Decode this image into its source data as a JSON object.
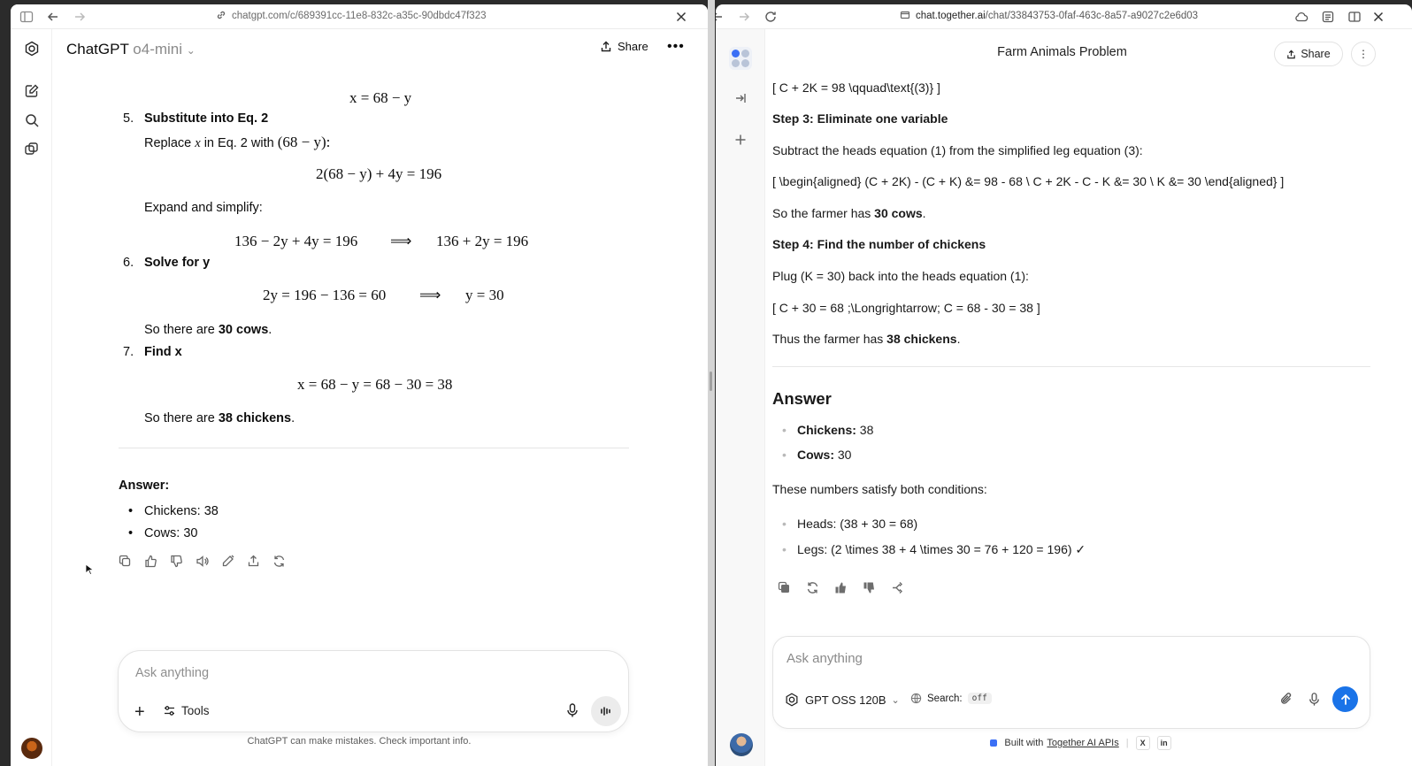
{
  "left": {
    "url": "chatgpt.com/c/689391cc-11e8-832c-a35c-90dbdc47f323",
    "app_name": "ChatGPT",
    "model": "o4-mini",
    "share_label": "Share",
    "more_label": "•••",
    "eq_top": "x = 68 − y",
    "steps": [
      {
        "num": "5.",
        "title": "Substitute into Eq. 2"
      },
      {
        "num": "6.",
        "title": "Solve for y"
      },
      {
        "num": "7.",
        "title": "Find x"
      }
    ],
    "replace_text_a": "Replace",
    "replace_text_b": "in Eq. 2 with",
    "replace_expr": "(68 − y):",
    "eq_sub": "2(68 − y) + 4y = 196",
    "expand_text": "Expand and simplify:",
    "eq_expand_a": "136 − 2y + 4y = 196",
    "implies": "⟹",
    "eq_expand_b": "136 + 2y = 196",
    "eq_solve_a": "2y = 196 − 136 = 60",
    "eq_solve_b": "y = 30",
    "so_there_are": "So there are",
    "cows_bold": "30 cows",
    "eq_x": "x = 68 − y = 68 − 30 = 38",
    "chickens_bold": "38 chickens",
    "period": ".",
    "answer_label": "Answer:",
    "answers": [
      "Chickens: 38",
      "Cows: 30"
    ],
    "composer_placeholder": "Ask anything",
    "tools_label": "Tools",
    "disclaimer": "ChatGPT can make mistakes. Check important info."
  },
  "right": {
    "url_domain": "chat.together.ai",
    "url_path": "/chat/33843753-0faf-463c-8a57-a9027c2e6d03",
    "title": "Farm Animals Problem",
    "share_label": "Share",
    "more_label": "⋮",
    "line1": "[ C + 2K = 98 \\qquad\\text{(3)} ]",
    "step3_label": "Step 3: Eliminate one variable",
    "subtract_text": "Subtract the heads equation (1) from the simplified leg equation (3):",
    "aligned": "[ \\begin{aligned} (C + 2K) - (C + K) &= 98 - 68 \\ C + 2K - C - K &= 30 \\ K &= 30 \\end{aligned} ]",
    "so_farmer": "So the farmer has",
    "cows_bold": "30 cows",
    "step4_label": "Step 4: Find the number of chickens",
    "plug_text": "Plug (K = 30) back into the heads equation (1):",
    "c_line": "[ C + 30 = 68 ;\\Longrightarrow; C = 68 - 30 = 38 ]",
    "thus_farmer": "Thus the farmer has",
    "chickens_bold": "38 chickens",
    "period": ".",
    "answer_heading": "Answer",
    "answer_items": [
      {
        "label": "Chickens:",
        "value": " 38"
      },
      {
        "label": "Cows:",
        "value": " 30"
      }
    ],
    "satisfy_text": "These numbers satisfy both conditions:",
    "conditions": [
      "Heads: (38 + 30 = 68)",
      "Legs: (2 \\times 38 + 4 \\times 30 = 76 + 120 = 196) ✓"
    ],
    "composer_placeholder": "Ask anything",
    "model_label": "GPT OSS 120B",
    "search_label": "Search:",
    "search_state": "off",
    "footer_text": "Built with",
    "footer_link": "Together AI APIs",
    "footer_x": "X",
    "footer_in": "in"
  },
  "colors": {
    "send_button": "#1a73e8",
    "chatgpt_text": "#0d0d0d"
  }
}
